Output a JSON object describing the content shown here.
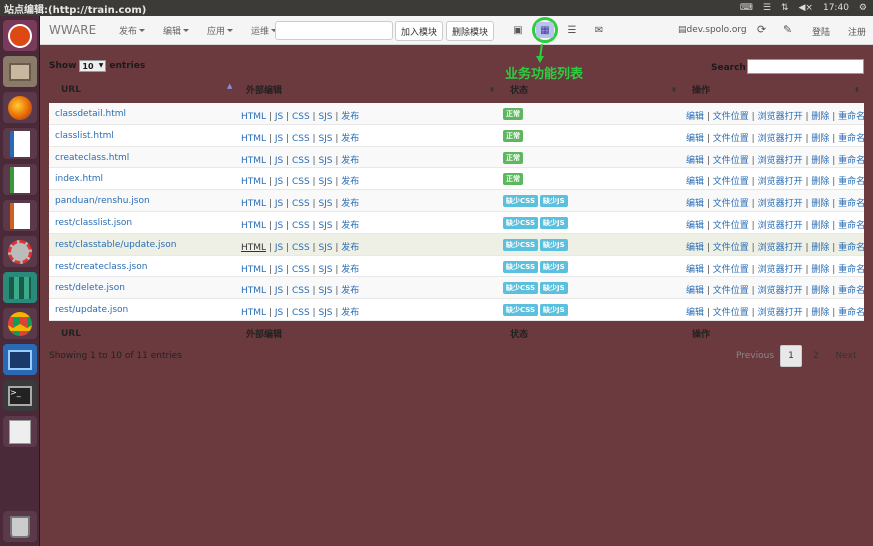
{
  "window": {
    "title": "站点编辑:(http://train.com)",
    "time": "17:40"
  },
  "toolbar": {
    "brand": "WWARE",
    "menus": [
      "发布",
      "编辑",
      "应用",
      "运维"
    ],
    "add_module": "加入模块",
    "delete_module": "删除模块",
    "host": "dev.spolo.org",
    "login": "登陆",
    "register": "注册"
  },
  "annotation": "业务功能列表",
  "controls": {
    "show_label": "Show",
    "entries_label": "entries",
    "page_size": "10",
    "search_label": "Search:"
  },
  "table": {
    "headers": [
      "URL",
      "外部编辑",
      "状态",
      "操作"
    ],
    "edit_links": [
      "HTML",
      "JS",
      "CSS",
      "SJS",
      "发布"
    ],
    "ops": [
      "编辑",
      "文件位置",
      "浏览器打开",
      "删除",
      "重命名"
    ],
    "rows": [
      {
        "url": "classdetail.html",
        "status": [
          "正常"
        ]
      },
      {
        "url": "classlist.html",
        "status": [
          "正常"
        ]
      },
      {
        "url": "createclass.html",
        "status": [
          "正常"
        ]
      },
      {
        "url": "index.html",
        "status": [
          "正常"
        ]
      },
      {
        "url": "panduan/renshu.json",
        "status": [
          "缺少CSS",
          "缺少JS"
        ]
      },
      {
        "url": "rest/classlist.json",
        "status": [
          "缺少CSS",
          "缺少JS"
        ]
      },
      {
        "url": "rest/classtable/update.json",
        "status": [
          "缺少CSS",
          "缺少JS"
        ]
      },
      {
        "url": "rest/createclass.json",
        "status": [
          "缺少CSS",
          "缺少JS"
        ]
      },
      {
        "url": "rest/delete.json",
        "status": [
          "缺少CSS",
          "缺少JS"
        ]
      },
      {
        "url": "rest/update.json",
        "status": [
          "缺少CSS",
          "缺少JS"
        ]
      }
    ]
  },
  "footer": {
    "info": "Showing 1 to 10 of 11 entries",
    "previous": "Previous",
    "pages": [
      "1",
      "2"
    ],
    "next": "Next"
  },
  "colors": {
    "accent": "#2ecc40",
    "link": "#2a6db5",
    "ok": "#5cb85c",
    "warn": "#5bc0de",
    "background": "#6b3a3e"
  }
}
